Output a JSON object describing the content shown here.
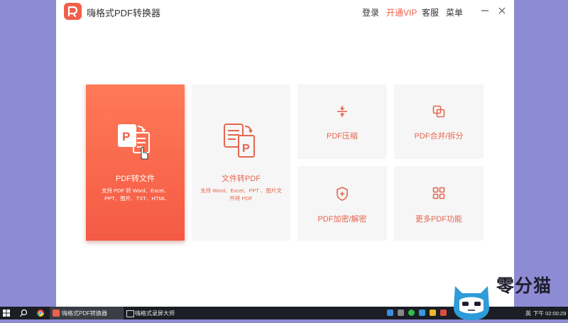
{
  "app": {
    "title": "嗨格式PDF转换器",
    "nav": {
      "login": "登录",
      "vip": "开通VIP",
      "service": "客服",
      "menu": "菜单"
    }
  },
  "tiles": {
    "pdf_to_file": {
      "label": "PDF转文件",
      "desc_line1": "支持 PDF 转 Word、Excel、",
      "desc_line2": "PPT、图片、TXT、HTML"
    },
    "file_to_pdf": {
      "label": "文件转PDF",
      "desc_line1": "支持 Word、Excel、PPT 、图片文",
      "desc_line2": "件转 PDF"
    },
    "compress": {
      "label": "PDF压缩"
    },
    "merge_split": {
      "label": "PDF合并/拆分"
    },
    "encrypt": {
      "label": "PDF加密/解密"
    },
    "more": {
      "label": "更多PDF功能"
    }
  },
  "taskbar": {
    "task1": "嗨格式PDF转换器",
    "task2": "嗨格式录屏大师",
    "lang": "英",
    "clock": "下午 02:00:29"
  },
  "watermark": {
    "text": "零分猫"
  },
  "colors": {
    "accent": "#f0604a",
    "tile_bg": "#f6f6f6",
    "desktop": "#8d8bd3",
    "taskbar": "#1b1e24"
  }
}
